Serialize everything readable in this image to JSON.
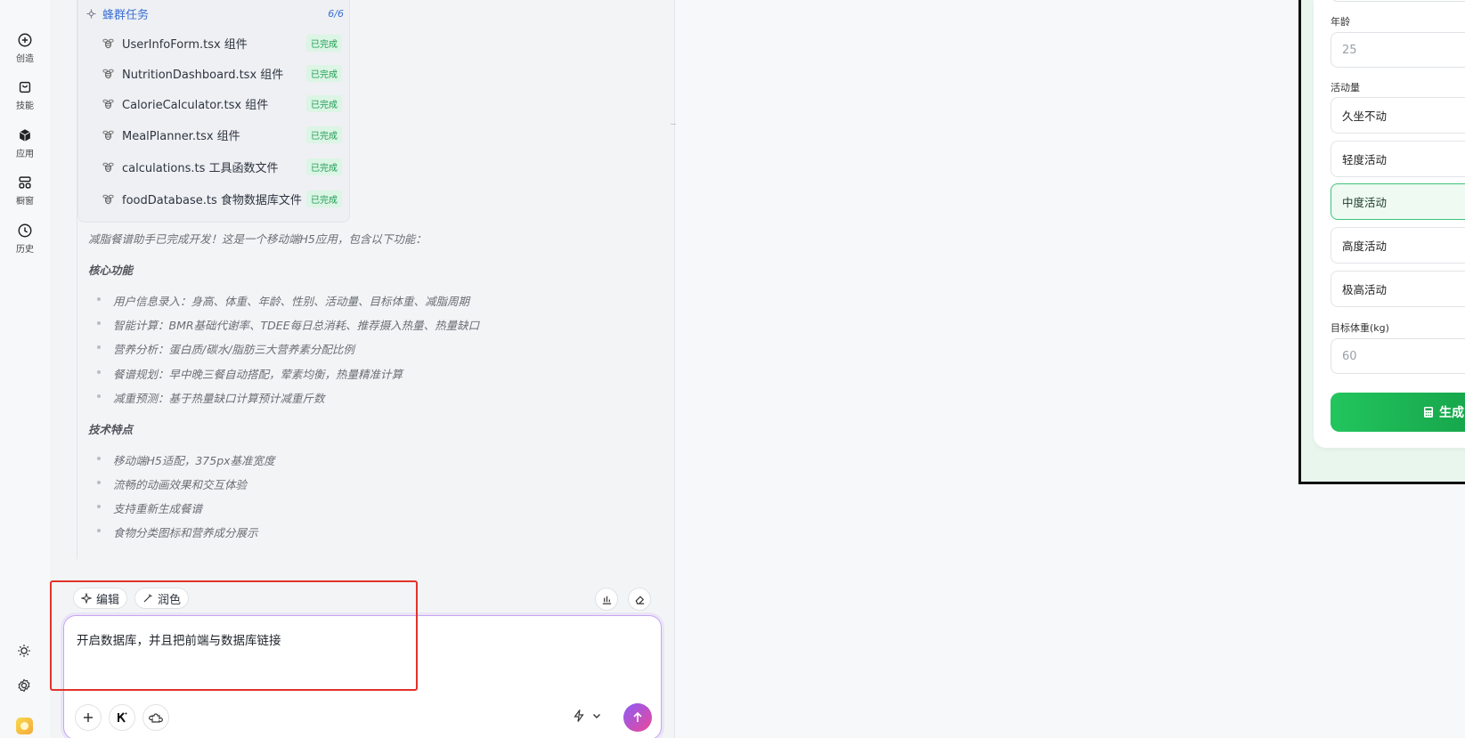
{
  "rail": {
    "items": [
      {
        "label": "创造",
        "icon": "plus-circle-icon"
      },
      {
        "label": "技能",
        "icon": "bag-icon"
      },
      {
        "label": "应用",
        "icon": "cube-icon"
      },
      {
        "label": "橱窗",
        "icon": "grid-icon"
      },
      {
        "label": "历史",
        "icon": "clock-icon"
      }
    ]
  },
  "swarm": {
    "title": "蜂群任务",
    "count": "6/6",
    "tasks": [
      {
        "name": "UserInfoForm.tsx 组件",
        "status": "已完成"
      },
      {
        "name": "NutritionDashboard.tsx 组件",
        "status": "已完成"
      },
      {
        "name": "CalorieCalculator.tsx 组件",
        "status": "已完成"
      },
      {
        "name": "MealPlanner.tsx 组件",
        "status": "已完成"
      },
      {
        "name": "calculations.ts 工具函数文件",
        "status": "已完成"
      },
      {
        "name": "foodDatabase.ts 食物数据库文件",
        "status": "已完成"
      }
    ]
  },
  "message": {
    "intro": "减脂餐谱助手已完成开发！这是一个移动端H5应用，包含以下功能：",
    "section1": "核心功能",
    "core": [
      "用户信息录入：身高、体重、年龄、性别、活动量、目标体重、减脂周期",
      "智能计算：BMR基础代谢率、TDEE每日总消耗、推荐摄入热量、热量缺口",
      "营养分析：蛋白质/碳水/脂肪三大营养素分配比例",
      "餐谱规划：早中晚三餐自动搭配，荤素均衡，热量精准计算",
      "减重预测：基于热量缺口计算预计减重斤数"
    ],
    "section2": "技术特点",
    "tech": [
      "移动端H5适配，375px基准宽度",
      "流畅的动画效果和交互体验",
      "支持重新生成餐谱",
      "食物分类图标和营养成分展示"
    ]
  },
  "composer": {
    "edit_label": "编辑",
    "polish_label": "润色",
    "input_value": "开启数据库，并且把前端与数据库链接"
  },
  "preview": {
    "age_label": "年龄",
    "age_placeholder": "25",
    "activity_label": "活动量",
    "activity_options": [
      "久坐不动",
      "轻度活动",
      "中度活动",
      "高度活动",
      "极高活动"
    ],
    "selected_activity": "中度活动",
    "target_label": "目标体重(kg)",
    "target_placeholder": "60",
    "generate_label": "生成"
  }
}
